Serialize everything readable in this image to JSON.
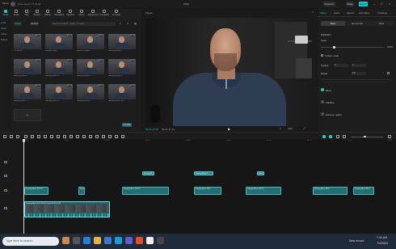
{
  "titlebar": {
    "menu": "Menu",
    "autosave": "Auto saved: 07:42:38",
    "title": "0704",
    "shortcuts_label": "Shortcuts",
    "share_label": "Share",
    "export_label": "Export",
    "accent_color": "#18c9cf"
  },
  "media_tabs": [
    "Media",
    "Audio",
    "Text",
    "Stickers",
    "Effects",
    "Transitions",
    "Captions",
    "Filters",
    "Adjustment",
    "Templates",
    "AI avatar"
  ],
  "media_left": [
    "Local",
    "Import",
    "Library",
    "Spaces"
  ],
  "media_panel": {
    "import_label": "Import",
    "record_label": "Record",
    "search_placeholder": "Search for videos, photos, or audio",
    "tiles": [
      {
        "label": "7/25/2024",
        "duration": "00:31"
      },
      {
        "label": "Shadow Mag...",
        "duration": "00:16"
      },
      {
        "label": "Geonorth Block...",
        "duration": "00:23"
      },
      {
        "label": "Seeding Block 2...",
        "duration": "00:28"
      },
      {
        "label": "Seeding Block 3...",
        "duration": "00:04"
      },
      {
        "label": "Seeding Block 4...",
        "duration": "00:12"
      },
      {
        "label": "Seeding Block 5...",
        "duration": "00:26"
      },
      {
        "label": "Seeding Block 6...",
        "duration": "00:31"
      },
      {
        "label": "Seeding Block 7...",
        "duration": "00:34"
      },
      {
        "label": "Seeding Block 8...",
        "duration": "00:19"
      },
      {
        "label": "Seeding Block 9...",
        "duration": "00:22"
      },
      {
        "label": "Seeding Block 10...",
        "duration": "00:15"
      }
    ],
    "import_tile_label": "+",
    "badge": "Ai-made"
  },
  "player": {
    "title": "Player",
    "timecode_current": "00:01:27:00",
    "timecode_total": "00:21:37:29",
    "controls_right": [
      "Full",
      "Ratio"
    ]
  },
  "properties": {
    "tabs": [
      "Video",
      "Audio",
      "Speed",
      "Animation",
      "Tracking",
      "Adjust"
    ],
    "subtabs": [
      "Basic",
      "Remove BG",
      "Mask"
    ],
    "transform_label": "Transform",
    "scale_label": "Scale",
    "scale_value": "100%",
    "uniform_scale": "Uniform scale",
    "position_label": "Position",
    "position_x": "0",
    "position_y": "0",
    "rotate_label": "Rotate",
    "rotate_value": "0.0°",
    "blend_label": "Blend",
    "stabilize_label": "Stabilize",
    "enhance_label": "Enhance quality"
  },
  "timeline": {
    "ruler": [
      "00:00",
      "00:10",
      "00:20",
      "00:30",
      "00:40",
      "00:50",
      "01:00",
      "01:10",
      "01:20",
      "01:30"
    ],
    "clips_text": [
      {
        "label": "Seeding Bl..."
      },
      {
        "label": "Seeding Block 2"
      },
      {
        "label": "Seed..."
      }
    ],
    "clips_upper": [
      {
        "label": "Seeding Block 2024 0..."
      },
      {
        "label": "Seed..."
      },
      {
        "label": "Seeding Block 2024 0"
      },
      {
        "label": "Seeding Block 2024"
      },
      {
        "label": "Seeding Block 2024 0"
      },
      {
        "label": "Seeding Block 2024"
      },
      {
        "label": "Seeding Block 2024"
      }
    ],
    "main_clip_label": "Seeding Block 2024 0704 (1).mp4  00:01:27:00"
  },
  "taskbar": {
    "search_placeholder": "Type here to search",
    "news": "New record",
    "time": "7:44 AM",
    "date": "7/4/2024"
  }
}
